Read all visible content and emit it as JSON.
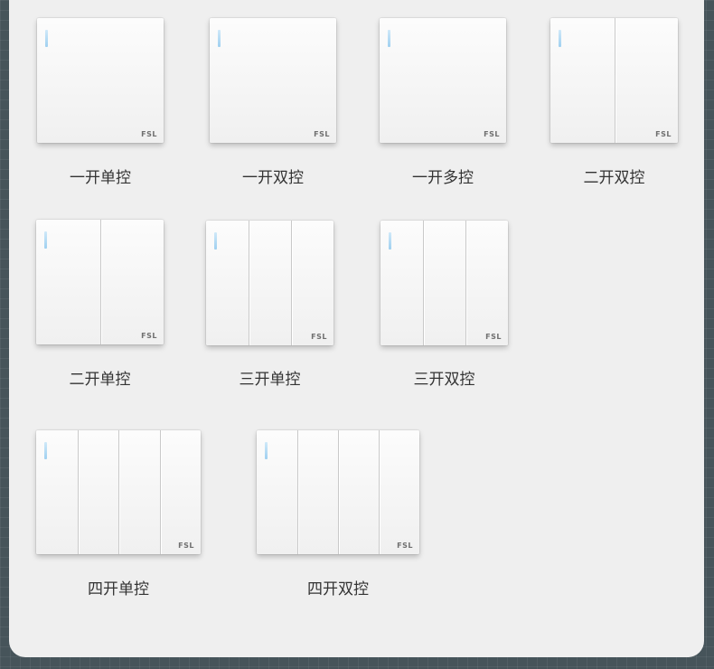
{
  "colors": {
    "background": "#46545a",
    "card": "#efefef",
    "panel": "#f7f7f7",
    "indicator": "#a8d4f2",
    "label_text": "#333333",
    "brand_text": "#6f6f6f"
  },
  "brand": "FSL",
  "switches": [
    {
      "label": "一开单控",
      "gangs": 1
    },
    {
      "label": "一开双控",
      "gangs": 1
    },
    {
      "label": "一开多控",
      "gangs": 1
    },
    {
      "label": "二开双控",
      "gangs": 2
    },
    {
      "label": "二开单控",
      "gangs": 2
    },
    {
      "label": "三开单控",
      "gangs": 3
    },
    {
      "label": "三开双控",
      "gangs": 3
    },
    {
      "label": "四开单控",
      "gangs": 4
    },
    {
      "label": "四开双控",
      "gangs": 4
    }
  ]
}
